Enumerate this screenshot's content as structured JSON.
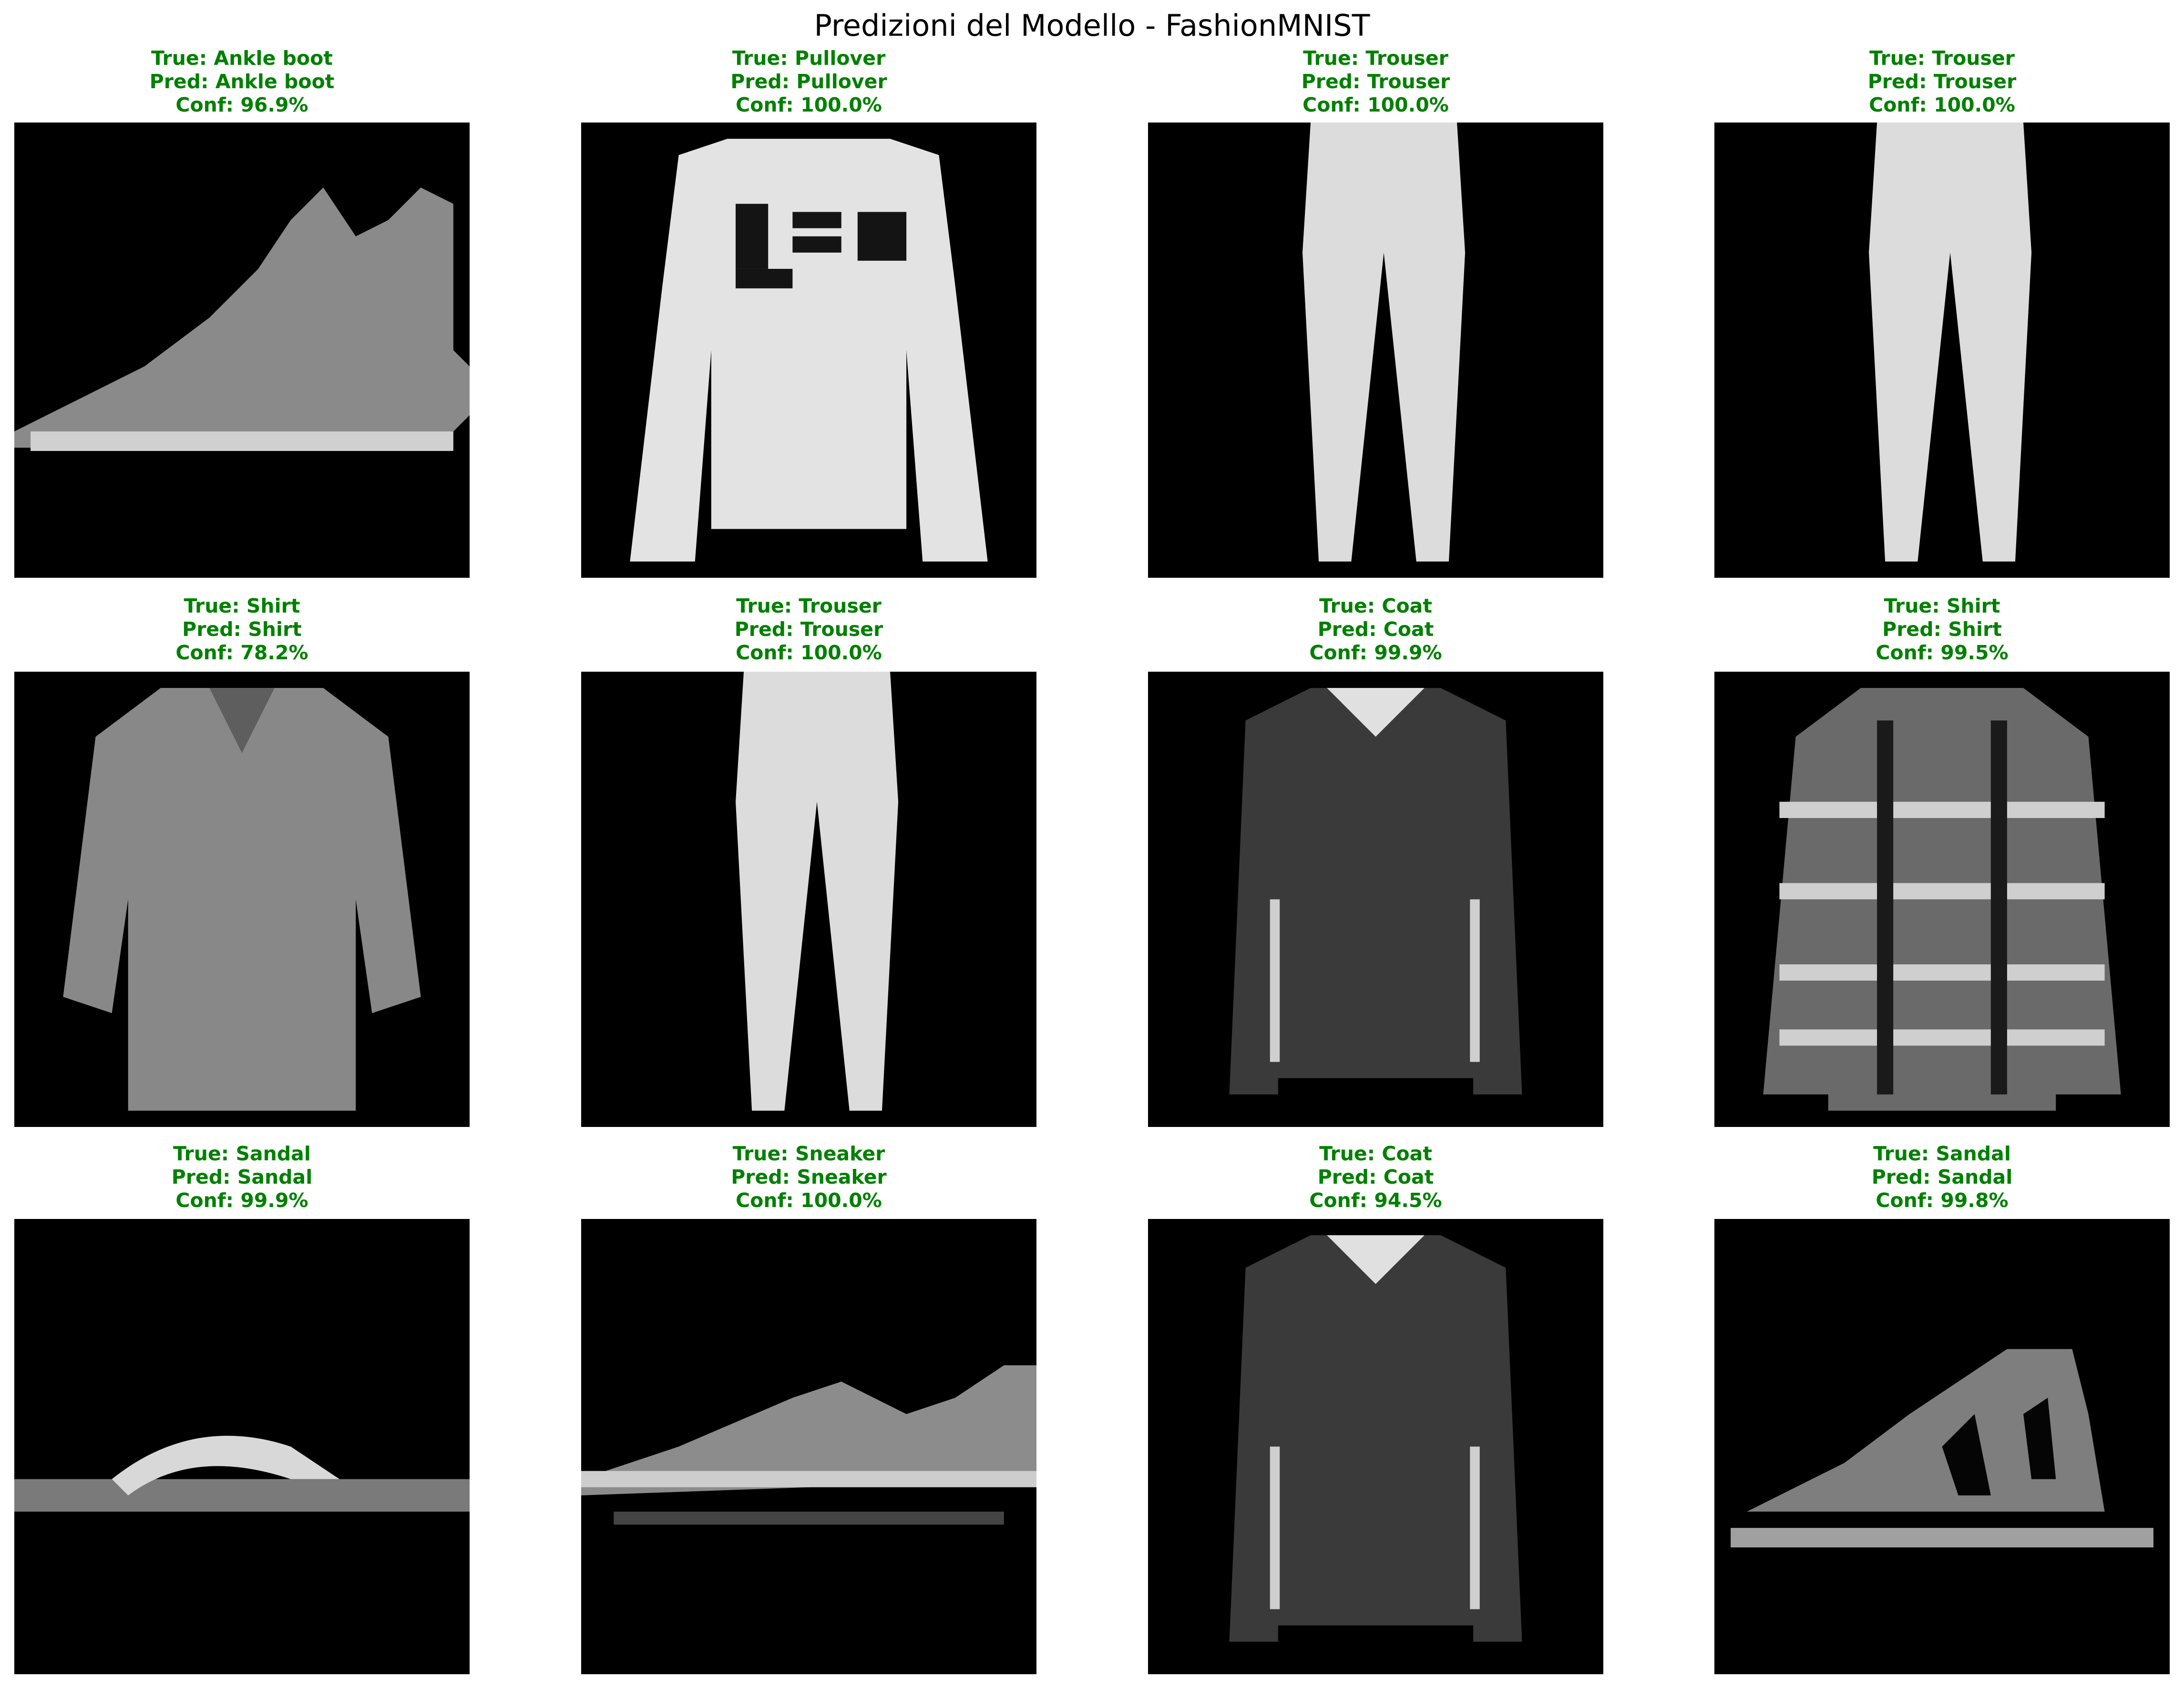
{
  "figure": {
    "title": "Predizioni del Modello - FashionMNIST"
  },
  "colors": {
    "correct_caption": "#008000",
    "image_background": "#000000"
  },
  "samples": [
    {
      "true_text": "True: Ankle boot",
      "pred_text": "Pred: Ankle boot",
      "conf_text": "Conf: 96.9%",
      "item": "ankle-boot"
    },
    {
      "true_text": "True: Pullover",
      "pred_text": "Pred: Pullover",
      "conf_text": "Conf: 100.0%",
      "item": "pullover"
    },
    {
      "true_text": "True: Trouser",
      "pred_text": "Pred: Trouser",
      "conf_text": "Conf: 100.0%",
      "item": "trouser"
    },
    {
      "true_text": "True: Trouser",
      "pred_text": "Pred: Trouser",
      "conf_text": "Conf: 100.0%",
      "item": "trouser"
    },
    {
      "true_text": "True: Shirt",
      "pred_text": "Pred: Shirt",
      "conf_text": "Conf: 78.2%",
      "item": "shirt"
    },
    {
      "true_text": "True: Trouser",
      "pred_text": "Pred: Trouser",
      "conf_text": "Conf: 100.0%",
      "item": "trouser"
    },
    {
      "true_text": "True: Coat",
      "pred_text": "Pred: Coat",
      "conf_text": "Conf: 99.9%",
      "item": "coat"
    },
    {
      "true_text": "True: Shirt",
      "pred_text": "Pred: Shirt",
      "conf_text": "Conf: 99.5%",
      "item": "plaid-shirt"
    },
    {
      "true_text": "True: Sandal",
      "pred_text": "Pred: Sandal",
      "conf_text": "Conf: 99.9%",
      "item": "sandal"
    },
    {
      "true_text": "True: Sneaker",
      "pred_text": "Pred: Sneaker",
      "conf_text": "Conf: 100.0%",
      "item": "sneaker"
    },
    {
      "true_text": "True: Coat",
      "pred_text": "Pred: Coat",
      "conf_text": "Conf: 94.5%",
      "item": "coat"
    },
    {
      "true_text": "True: Sandal",
      "pred_text": "Pred: Sandal",
      "conf_text": "Conf: 99.8%",
      "item": "sandal-strappy"
    }
  ]
}
